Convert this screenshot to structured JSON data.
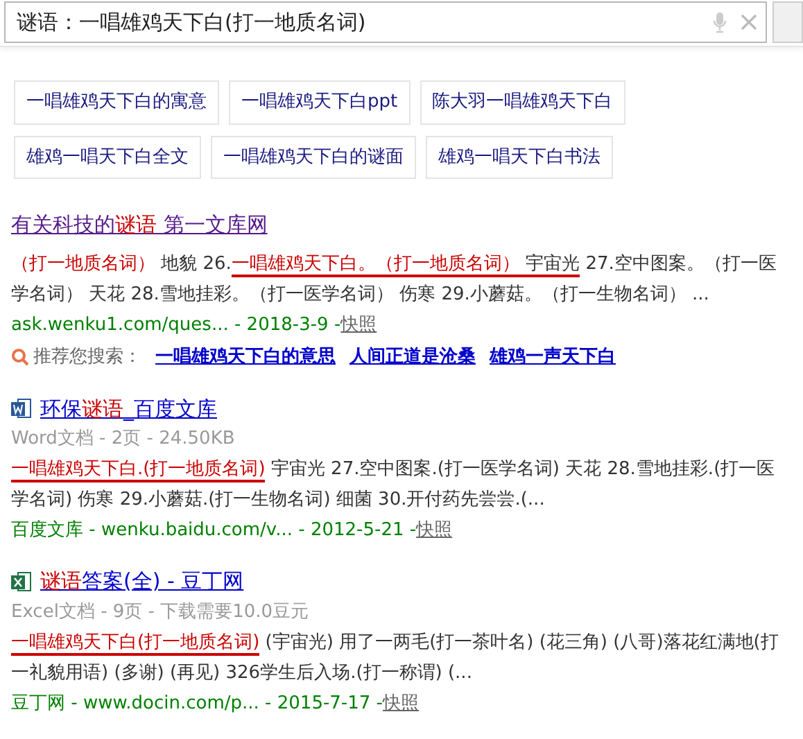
{
  "search": {
    "value": "谜语：一唱雄鸡天下白(打一地质名词)"
  },
  "related": [
    [
      "一唱雄鸡天下白的寓意",
      "一唱雄鸡天下白ppt",
      "陈大羽一唱雄鸡天下白"
    ],
    [
      "雄鸡一唱天下白全文",
      "一唱雄鸡天下白的谜面",
      "雄鸡一唱天下白书法"
    ]
  ],
  "results": [
    {
      "kind": "plain",
      "title": [
        {
          "text": "有关科技的",
          "hit": false
        },
        {
          "text": "谜语",
          "hit": true
        },
        {
          "text": " 第一文库网",
          "hit": false
        }
      ],
      "visited": true,
      "snippet": [
        {
          "text": "（打一地质名词）",
          "hit": true,
          "underlined": false
        },
        {
          "text": " 地貌 26.",
          "hit": false,
          "underlined": false
        },
        {
          "text": "一唱雄鸡天下白。（打一地质名词）",
          "hit": true,
          "underlined": true
        },
        {
          "text": " 宇宙光",
          "hit": false,
          "underlined": true
        },
        {
          "text": " 27.空中图案。（打一医学名词） 天花 28.雪地挂彩。（打一医学名词） 伤寒 29.小蘑菇。（打一生物名词） ...",
          "hit": false,
          "underlined": false
        }
      ],
      "source": "ask.wenku1.com/ques... - 2018-3-9 - ",
      "cache": "快照",
      "recommend": {
        "label": "推荐您搜索：",
        "links": [
          "一唱雄鸡天下白的意思",
          "人间正道是沧桑",
          "雄鸡一声天下白"
        ]
      }
    },
    {
      "kind": "word",
      "title": [
        {
          "text": "环保",
          "hit": false
        },
        {
          "text": "谜语",
          "hit": true
        },
        {
          "text": "_百度文库",
          "hit": false
        }
      ],
      "visited": false,
      "meta": "Word文档 - 2页 - 24.50KB",
      "snippet": [
        {
          "text": "一唱雄鸡天下白.(打一地质名词)",
          "hit": true,
          "underlined": true
        },
        {
          "text": " 宇宙光 27.空中图案.(打一医学名词) 天花 28.雪地挂彩.(打一医学名词) 伤寒 29.小蘑菇.(打一生物名词) 细菌 30.开付药先尝尝.(...",
          "hit": false,
          "underlined": false
        }
      ],
      "source": "百度文库 - wenku.baidu.com/v... - 2012-5-21 - ",
      "cache": "快照"
    },
    {
      "kind": "excel",
      "title": [
        {
          "text": "谜语",
          "hit": true
        },
        {
          "text": "答案(全) - 豆丁网",
          "hit": false
        }
      ],
      "visited": false,
      "meta": "Excel文档 - 9页 - 下载需要10.0豆元",
      "snippet": [
        {
          "text": "一唱雄鸡天下白(打一地质名词)",
          "hit": true,
          "underlined": true
        },
        {
          "text": " (宇宙光) 用了一两毛(打一茶叶名) (花三角) (八哥)落花红满地(打一礼貌用语) (多谢) (再见) 326学生后入场.(打一称谓) (...",
          "hit": false,
          "underlined": false
        }
      ],
      "source": "豆丁网 - www.docin.com/p... - 2015-7-17 - ",
      "cache": "快照"
    }
  ]
}
